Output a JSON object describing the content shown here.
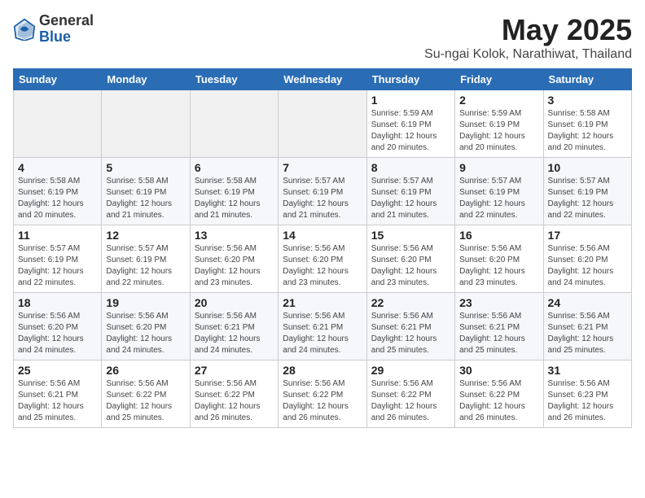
{
  "header": {
    "logo_general": "General",
    "logo_blue": "Blue",
    "title": "May 2025",
    "subtitle": "Su-ngai Kolok, Narathiwat, Thailand"
  },
  "weekdays": [
    "Sunday",
    "Monday",
    "Tuesday",
    "Wednesday",
    "Thursday",
    "Friday",
    "Saturday"
  ],
  "weeks": [
    [
      {
        "day": "",
        "info": ""
      },
      {
        "day": "",
        "info": ""
      },
      {
        "day": "",
        "info": ""
      },
      {
        "day": "",
        "info": ""
      },
      {
        "day": "1",
        "info": "Sunrise: 5:59 AM\nSunset: 6:19 PM\nDaylight: 12 hours\nand 20 minutes."
      },
      {
        "day": "2",
        "info": "Sunrise: 5:59 AM\nSunset: 6:19 PM\nDaylight: 12 hours\nand 20 minutes."
      },
      {
        "day": "3",
        "info": "Sunrise: 5:58 AM\nSunset: 6:19 PM\nDaylight: 12 hours\nand 20 minutes."
      }
    ],
    [
      {
        "day": "4",
        "info": "Sunrise: 5:58 AM\nSunset: 6:19 PM\nDaylight: 12 hours\nand 20 minutes."
      },
      {
        "day": "5",
        "info": "Sunrise: 5:58 AM\nSunset: 6:19 PM\nDaylight: 12 hours\nand 21 minutes."
      },
      {
        "day": "6",
        "info": "Sunrise: 5:58 AM\nSunset: 6:19 PM\nDaylight: 12 hours\nand 21 minutes."
      },
      {
        "day": "7",
        "info": "Sunrise: 5:57 AM\nSunset: 6:19 PM\nDaylight: 12 hours\nand 21 minutes."
      },
      {
        "day": "8",
        "info": "Sunrise: 5:57 AM\nSunset: 6:19 PM\nDaylight: 12 hours\nand 21 minutes."
      },
      {
        "day": "9",
        "info": "Sunrise: 5:57 AM\nSunset: 6:19 PM\nDaylight: 12 hours\nand 22 minutes."
      },
      {
        "day": "10",
        "info": "Sunrise: 5:57 AM\nSunset: 6:19 PM\nDaylight: 12 hours\nand 22 minutes."
      }
    ],
    [
      {
        "day": "11",
        "info": "Sunrise: 5:57 AM\nSunset: 6:19 PM\nDaylight: 12 hours\nand 22 minutes."
      },
      {
        "day": "12",
        "info": "Sunrise: 5:57 AM\nSunset: 6:19 PM\nDaylight: 12 hours\nand 22 minutes."
      },
      {
        "day": "13",
        "info": "Sunrise: 5:56 AM\nSunset: 6:20 PM\nDaylight: 12 hours\nand 23 minutes."
      },
      {
        "day": "14",
        "info": "Sunrise: 5:56 AM\nSunset: 6:20 PM\nDaylight: 12 hours\nand 23 minutes."
      },
      {
        "day": "15",
        "info": "Sunrise: 5:56 AM\nSunset: 6:20 PM\nDaylight: 12 hours\nand 23 minutes."
      },
      {
        "day": "16",
        "info": "Sunrise: 5:56 AM\nSunset: 6:20 PM\nDaylight: 12 hours\nand 23 minutes."
      },
      {
        "day": "17",
        "info": "Sunrise: 5:56 AM\nSunset: 6:20 PM\nDaylight: 12 hours\nand 24 minutes."
      }
    ],
    [
      {
        "day": "18",
        "info": "Sunrise: 5:56 AM\nSunset: 6:20 PM\nDaylight: 12 hours\nand 24 minutes."
      },
      {
        "day": "19",
        "info": "Sunrise: 5:56 AM\nSunset: 6:20 PM\nDaylight: 12 hours\nand 24 minutes."
      },
      {
        "day": "20",
        "info": "Sunrise: 5:56 AM\nSunset: 6:21 PM\nDaylight: 12 hours\nand 24 minutes."
      },
      {
        "day": "21",
        "info": "Sunrise: 5:56 AM\nSunset: 6:21 PM\nDaylight: 12 hours\nand 24 minutes."
      },
      {
        "day": "22",
        "info": "Sunrise: 5:56 AM\nSunset: 6:21 PM\nDaylight: 12 hours\nand 25 minutes."
      },
      {
        "day": "23",
        "info": "Sunrise: 5:56 AM\nSunset: 6:21 PM\nDaylight: 12 hours\nand 25 minutes."
      },
      {
        "day": "24",
        "info": "Sunrise: 5:56 AM\nSunset: 6:21 PM\nDaylight: 12 hours\nand 25 minutes."
      }
    ],
    [
      {
        "day": "25",
        "info": "Sunrise: 5:56 AM\nSunset: 6:21 PM\nDaylight: 12 hours\nand 25 minutes."
      },
      {
        "day": "26",
        "info": "Sunrise: 5:56 AM\nSunset: 6:22 PM\nDaylight: 12 hours\nand 25 minutes."
      },
      {
        "day": "27",
        "info": "Sunrise: 5:56 AM\nSunset: 6:22 PM\nDaylight: 12 hours\nand 26 minutes."
      },
      {
        "day": "28",
        "info": "Sunrise: 5:56 AM\nSunset: 6:22 PM\nDaylight: 12 hours\nand 26 minutes."
      },
      {
        "day": "29",
        "info": "Sunrise: 5:56 AM\nSunset: 6:22 PM\nDaylight: 12 hours\nand 26 minutes."
      },
      {
        "day": "30",
        "info": "Sunrise: 5:56 AM\nSunset: 6:22 PM\nDaylight: 12 hours\nand 26 minutes."
      },
      {
        "day": "31",
        "info": "Sunrise: 5:56 AM\nSunset: 6:23 PM\nDaylight: 12 hours\nand 26 minutes."
      }
    ]
  ]
}
